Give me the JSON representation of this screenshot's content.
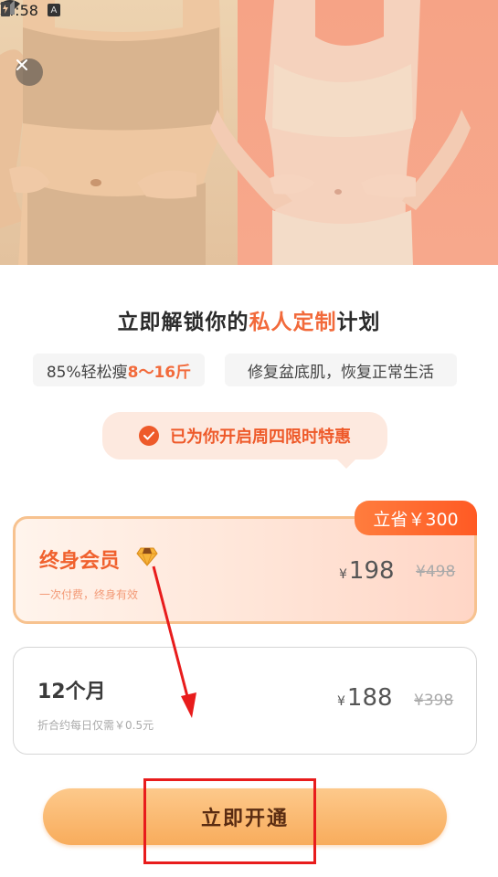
{
  "status_bar": {
    "time": "4:58",
    "badge": "A"
  },
  "title": {
    "prefix": "立即解锁你的",
    "highlight": "私人定制",
    "suffix": "计划"
  },
  "tags": [
    {
      "prefix": "85%轻松瘦",
      "highlight": "8～16斤"
    },
    {
      "text": "修复盆底肌，恢复正常生活"
    }
  ],
  "promo": {
    "text": "已为你开启周四限时特惠"
  },
  "plans": [
    {
      "name": "终身会员",
      "subtitle": "一次付费，终身有效",
      "currency": "¥",
      "price": "198",
      "original_price": "¥498",
      "badge": "立省￥300",
      "selected": true
    },
    {
      "name": "12个月",
      "subtitle": "折合约每日仅需￥0.5元",
      "currency": "¥",
      "price": "188",
      "original_price": "¥398",
      "selected": false
    }
  ],
  "cta": {
    "label": "立即开通"
  },
  "colors": {
    "accent": "#f26a3b",
    "cta_gradient_top": "#fdc98b",
    "cta_gradient_bottom": "#f8ac5c",
    "annotation_red": "#e81c1c"
  }
}
